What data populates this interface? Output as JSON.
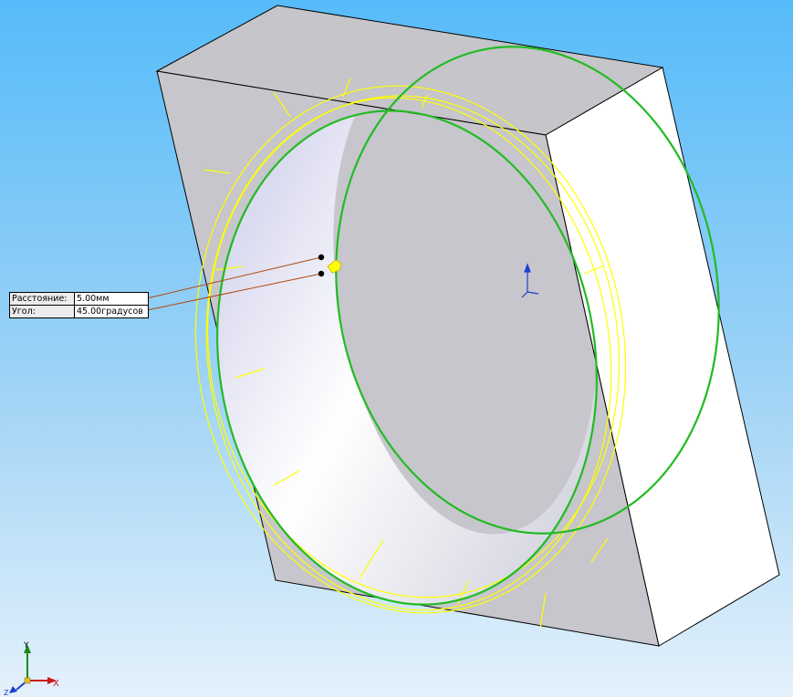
{
  "colors": {
    "background_top": "#5bbdf8",
    "background_bottom": "#ddeefa",
    "body_front": "#c6c6cc",
    "body_top": "#c4c4c9",
    "body_right": "#ffffff",
    "edge": "#000000",
    "preview_curve": "#ffff00",
    "selected_curve": "#22bb22",
    "leader_line": "#b04a10"
  },
  "callout": {
    "distance_label": "Расстояние:",
    "distance_value": "5.00мм",
    "angle_label": "Угол:",
    "angle_value": "45.00градусов"
  },
  "triad": {
    "x_label": "X",
    "y_label": "Y",
    "z_label": "Z"
  },
  "icons": {
    "chamfer_handle": "yellow-arrow-handle-icon",
    "origin_marker": "origin-icon",
    "view_triad": "xyz-triad-icon"
  }
}
